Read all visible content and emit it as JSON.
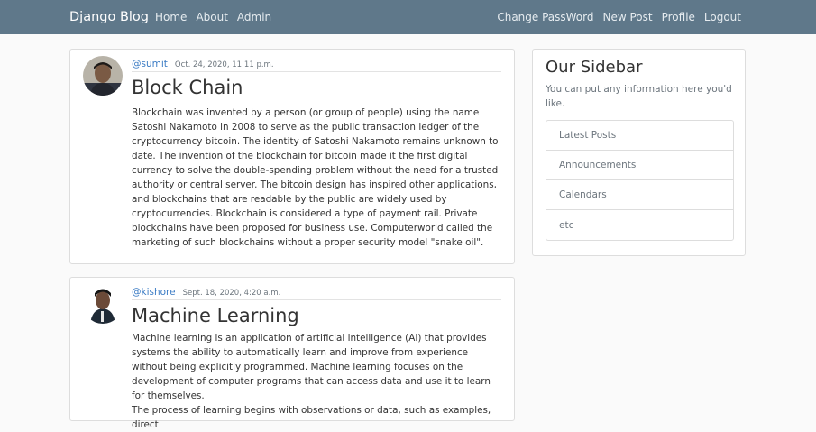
{
  "navbar": {
    "brand": "Django Blog",
    "left_links": [
      "Home",
      "About",
      "Admin"
    ],
    "right_links": [
      "Change PassWord",
      "New Post",
      "Profile",
      "Logout"
    ],
    "background_color": "#5f788a"
  },
  "posts": [
    {
      "author": "@sumit",
      "date": "Oct. 24, 2020, 11:11 p.m.",
      "title": "Block Chain",
      "body": "Blockchain was invented by a person (or group of people) using the name Satoshi Nakamoto in 2008 to serve as the public transaction ledger of the cryptocurrency bitcoin. The identity of Satoshi Nakamoto remains unknown to date. The invention of the blockchain for bitcoin made it the first digital currency to solve the double-spending problem without the need for a trusted authority or central server. The bitcoin design has inspired other applications, and blockchains that are readable by the public are widely used by cryptocurrencies. Blockchain is considered a type of payment rail. Private blockchains have been proposed for business use. Computerworld called the marketing of such blockchains without a proper security model \"snake oil\"."
    },
    {
      "author": "@kishore",
      "date": "Sept. 18, 2020, 4:20 a.m.",
      "title": "Machine Learning",
      "body_lines": [
        "Machine learning is an application of artificial intelligence (AI) that provides systems the ability to automatically learn and improve from experience without being explicitly programmed. Machine learning focuses on the development of computer programs that can access data and use it to learn for themselves.",
        "The process of learning begins with observations or data, such as examples, direct"
      ]
    }
  ],
  "sidebar": {
    "title": "Our Sidebar",
    "text": "You can put any information here you'd like.",
    "items": [
      "Latest Posts",
      "Announcements",
      "Calendars",
      "etc"
    ]
  },
  "colors": {
    "link": "#3a7bc4",
    "muted": "#6c757d",
    "page_background": "#fafafa"
  }
}
